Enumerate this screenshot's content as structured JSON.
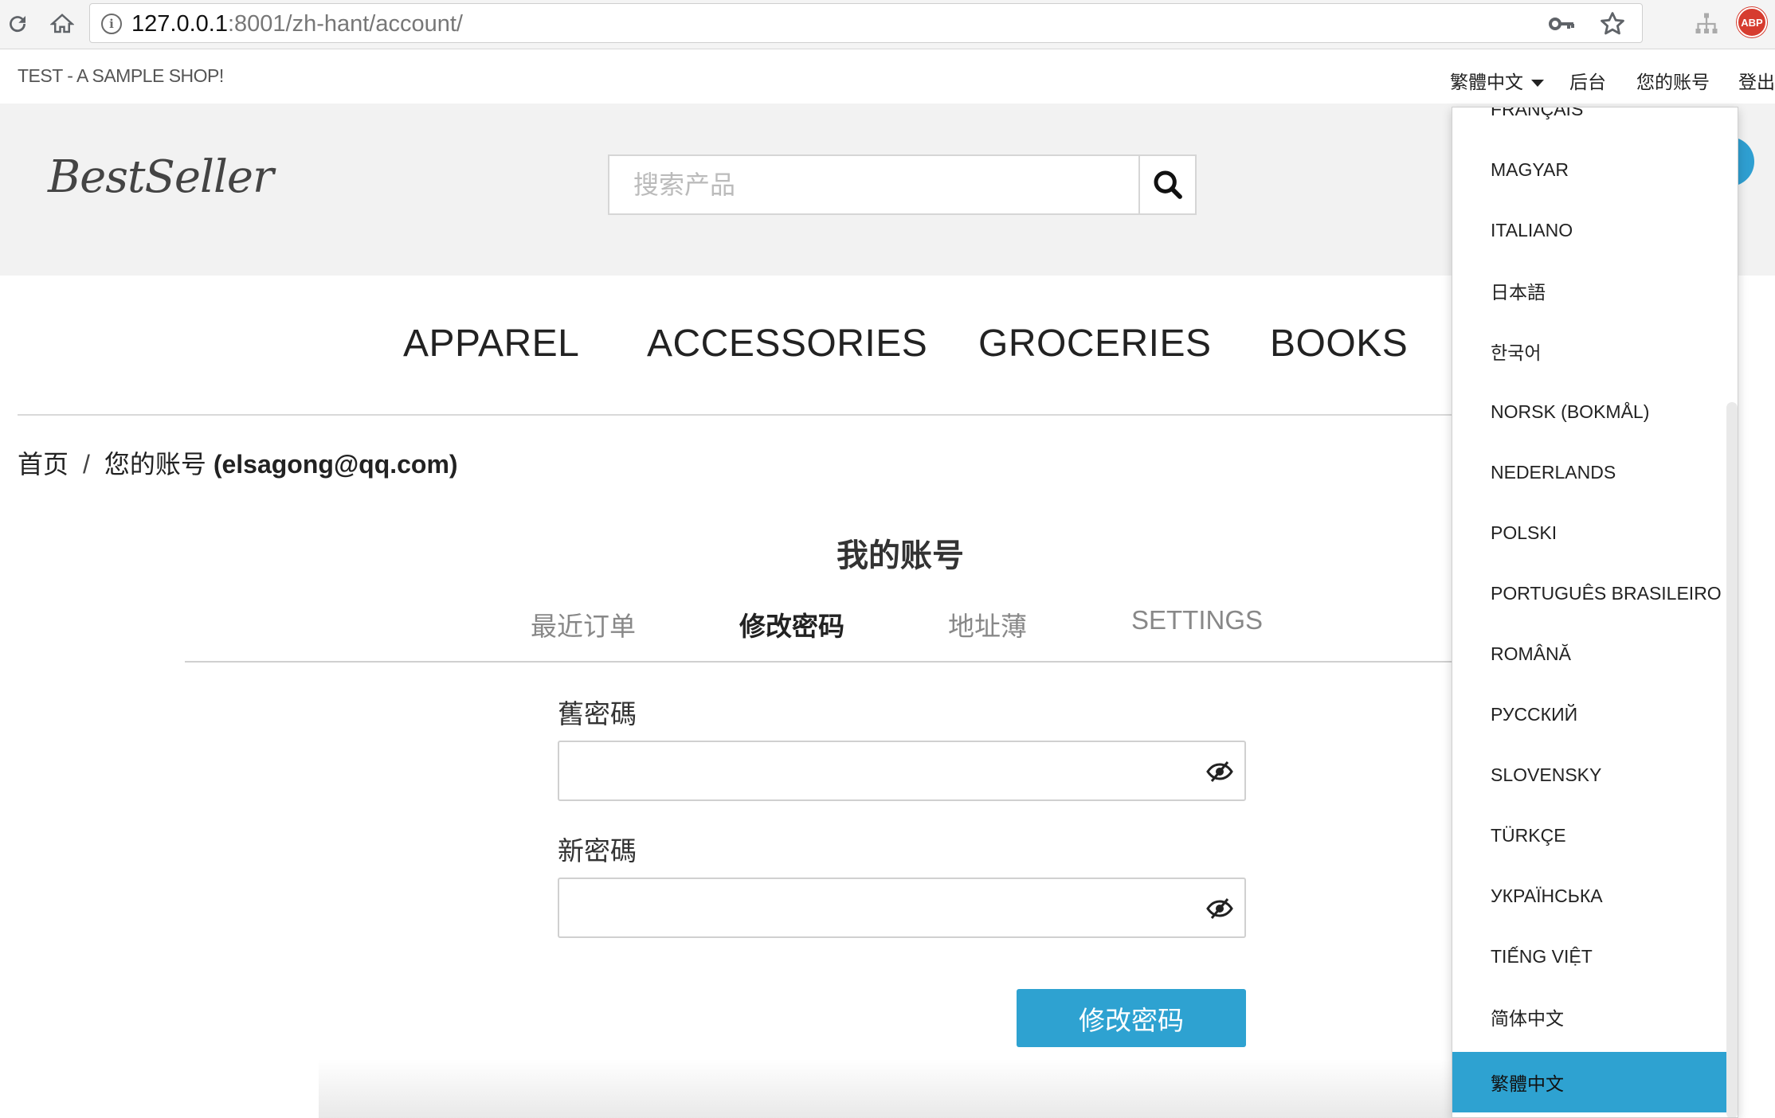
{
  "browser": {
    "url_host": "127.0.0.1",
    "url_rest": ":8001/zh-hant/account/",
    "extension_abp": "ABP"
  },
  "topbar": {
    "shop_name": "TEST - A SAMPLE SHOP!",
    "language": "繁體中文",
    "admin": "后台",
    "account": "您的账号",
    "logout": "登出"
  },
  "header": {
    "logo": "BestSeller",
    "search_placeholder": "搜索产品"
  },
  "nav": {
    "items": [
      "APPAREL",
      "ACCESSORIES",
      "GROCERIES",
      "BOOKS"
    ]
  },
  "breadcrumb": {
    "home": "首页",
    "separator": "/",
    "current": "您的账号",
    "email": "(elsagong@qq.com)"
  },
  "account": {
    "title": "我的账号",
    "tabs": [
      "最近订单",
      "修改密码",
      "地址薄",
      "SETTINGS"
    ],
    "active_tab": "修改密码",
    "old_password_label": "舊密碼",
    "new_password_label": "新密碼",
    "submit_label": "修改密码"
  },
  "language_menu": {
    "items": [
      "FRANÇAIS",
      "MAGYAR",
      "ITALIANO",
      "日本語",
      "한국어",
      "NORSK (BOKMÅL)",
      "NEDERLANDS",
      "POLSKI",
      "PORTUGUÊS BRASILEIRO",
      "ROMÂNĂ",
      "РУССКИЙ",
      "SLOVENSKY",
      "TÜRKÇE",
      "УКРАЇНСЬКА",
      "TIẾNG VIỆT",
      "简体中文",
      "繁體中文"
    ],
    "selected": "繁體中文"
  },
  "colors": {
    "accent": "#2ea2d1",
    "header_bg": "#f2f2f2",
    "abp_red": "#d63c2f"
  }
}
